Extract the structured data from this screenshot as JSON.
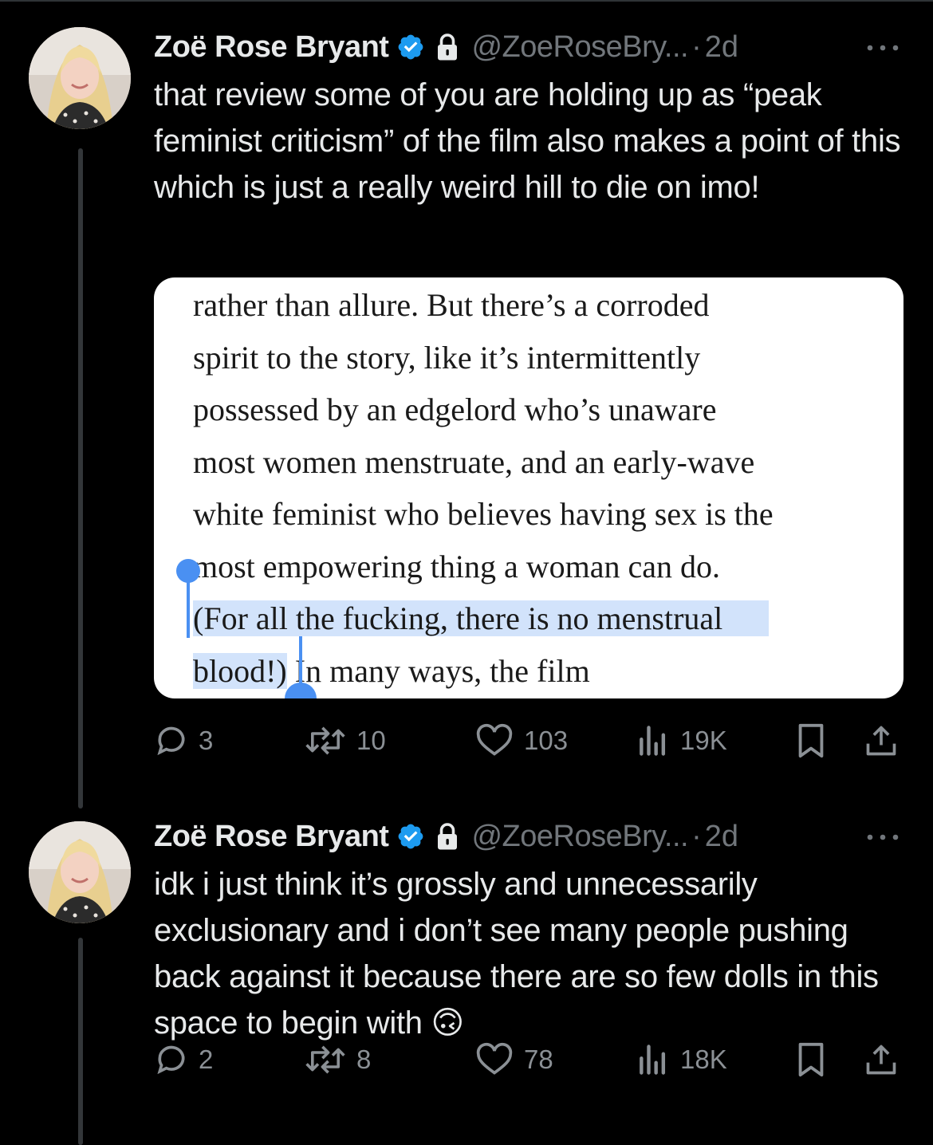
{
  "tweets": [
    {
      "author_name": "Zoë Rose Bryant",
      "handle": "@ZoeRoseBry...",
      "separator": "·",
      "time": "2d",
      "text": "that review some of you are holding up as “peak feminist criticism” of the film also makes a point of this which is just a really weird hill to die on imo!",
      "media": {
        "lines": [
          "rather than allure. But there’s a corroded",
          "spirit to the story, like it’s intermittently",
          "possessed by an edgelord who’s unaware",
          "most women menstruate, and an early-wave",
          "white feminist who believes having sex is the",
          "most empowering thing a woman can do."
        ],
        "highlighted_line": "(For all the fucking, there is no menstrual",
        "highlighted_tail": "blood!)",
        "tail_rest": " In many ways, the film"
      },
      "stats": {
        "replies": "3",
        "reposts": "10",
        "likes": "103",
        "views": "19K"
      }
    },
    {
      "author_name": "Zoë Rose Bryant",
      "handle": "@ZoeRoseBry...",
      "separator": "·",
      "time": "2d",
      "text": "idk i just think it’s grossly and unnecessarily exclusionary and i don’t see many people pushing back against it because there are so few dolls in this space to begin with 🙃",
      "stats": {
        "replies": "2",
        "reposts": "8",
        "likes": "78",
        "views": "18K"
      }
    }
  ],
  "colors": {
    "background": "#000000",
    "text": "#e7e9ea",
    "secondary": "#71767b",
    "verified": "#1d9bf0",
    "selection": "#d2e3fb"
  },
  "icons": [
    "verified-badge-icon",
    "lock-icon",
    "more-icon",
    "reply-icon",
    "repost-icon",
    "like-icon",
    "views-icon",
    "bookmark-icon",
    "share-icon"
  ]
}
